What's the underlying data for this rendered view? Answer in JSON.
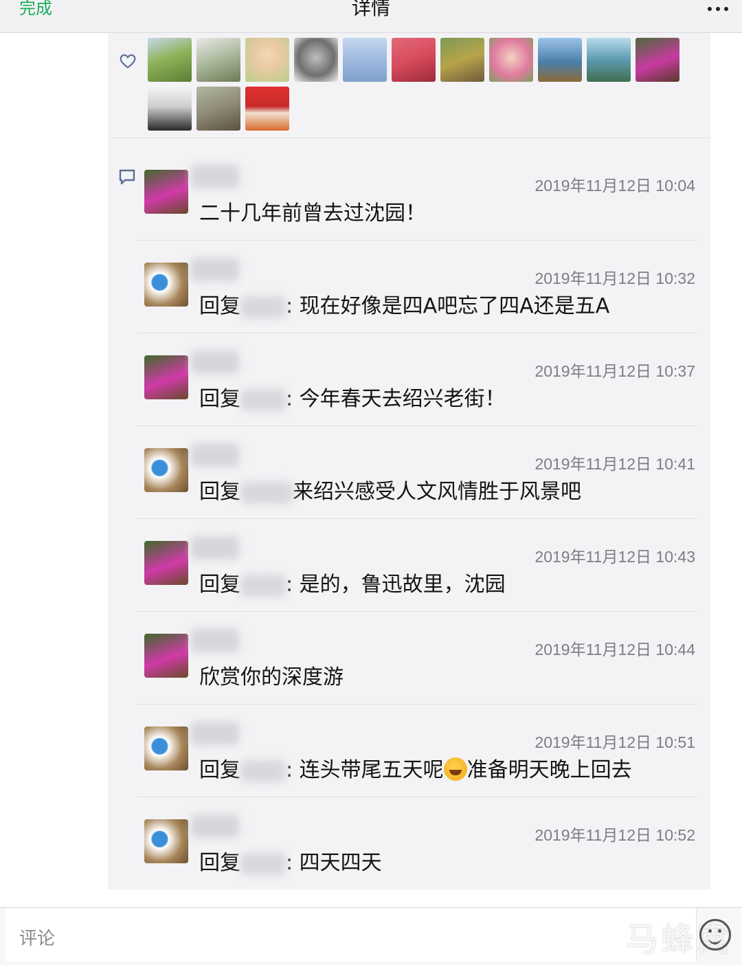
{
  "nav": {
    "done_label": "完成",
    "title": "详情",
    "more_icon": "more-dots-icon"
  },
  "likes": {
    "icon": "heart-icon",
    "avatars": [
      "#8fb35a",
      "#aab89a",
      "#e8c9a2",
      "#6f6f6f",
      "#9cb7de",
      "#d84a5c",
      "#b7a44a",
      "#e07ba0",
      "#4a7fa8",
      "#5d9ab0",
      "#c83aa0",
      "#cfcfcf",
      "#8f8a78",
      "#c82b2b"
    ]
  },
  "comments": {
    "icon": "comment-bubble-icon",
    "items": [
      {
        "avatar": "woman-pink",
        "time": "2019年11月12日 10:04",
        "is_reply": false,
        "prefix": "",
        "text": "二十几年前曾去过沈园！"
      },
      {
        "avatar": "doraemon",
        "time": "2019年11月12日 10:32",
        "is_reply": true,
        "prefix": "回复",
        "text": ": 现在好像是四A吧忘了四A还是五A"
      },
      {
        "avatar": "woman-pink",
        "time": "2019年11月12日 10:37",
        "is_reply": true,
        "prefix": "回复",
        "text": ": 今年春天去绍兴老街！"
      },
      {
        "avatar": "doraemon",
        "time": "2019年11月12日 10:41",
        "is_reply": true,
        "prefix": "回复",
        "text": "来绍兴感受人文风情胜于风景吧"
      },
      {
        "avatar": "woman-pink",
        "time": "2019年11月12日 10:43",
        "is_reply": true,
        "prefix": "回复",
        "text": ": 是的，鲁迅故里，沈园"
      },
      {
        "avatar": "woman-pink",
        "time": "2019年11月12日 10:44",
        "is_reply": false,
        "prefix": "",
        "text": "欣赏你的深度游"
      },
      {
        "avatar": "doraemon",
        "time": "2019年11月12日 10:51",
        "is_reply": true,
        "prefix": "回复",
        "text_before": ": 连头带尾五天呢",
        "emoji": "crying-laughing-emoji",
        "text_after": "准备明天晚上回去"
      },
      {
        "avatar": "doraemon",
        "time": "2019年11月12日 10:52",
        "is_reply": true,
        "prefix": "回复",
        "text": ": 四天四天"
      }
    ]
  },
  "input": {
    "placeholder": "评论",
    "emoji_icon": "smiley-icon"
  },
  "watermark": "马蜂窝"
}
